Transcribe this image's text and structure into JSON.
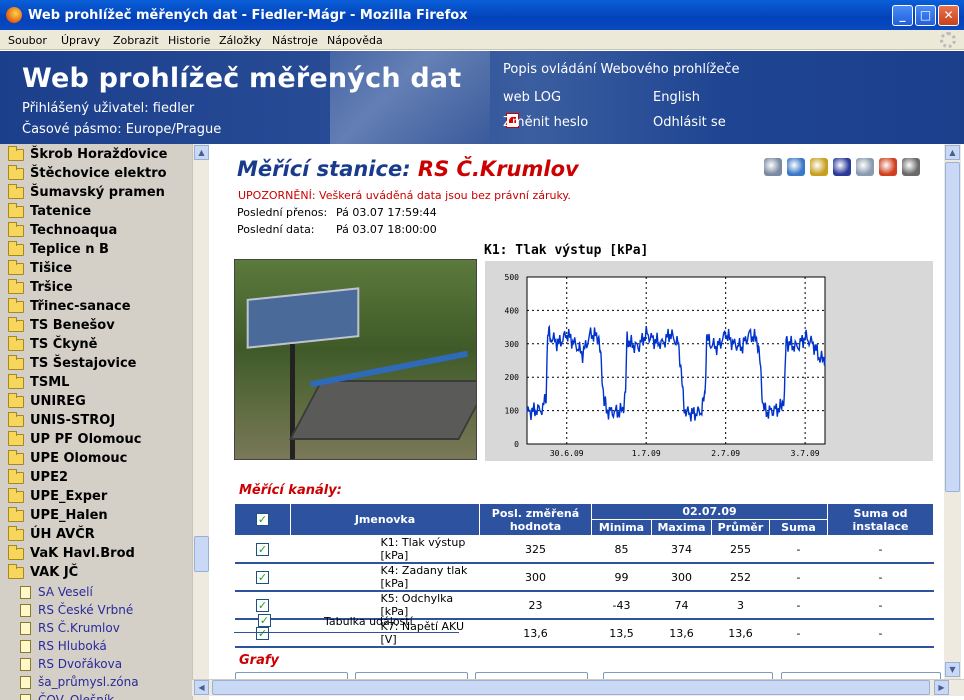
{
  "window": {
    "title": "Web prohlížeč měřených dat - Fiedler-Mágr - Mozilla Firefox"
  },
  "menu": [
    "Soubor",
    "Úpravy",
    "Zobrazit",
    "Historie",
    "Záložky",
    "Nástroje",
    "Nápověda"
  ],
  "banner": {
    "title": "Web prohlížeč měřených dat",
    "user": "Přihlášený uživatel: fiedler",
    "timezone": "Časové pásmo: Europe/Prague",
    "help_link": "Popis ovládání Webového prohlížeče",
    "weblog": "web LOG",
    "english": "English",
    "change_password": "Změnit heslo",
    "logout": "Odhlásit se"
  },
  "sidebar": {
    "folders": [
      "Škrob Horažďovice",
      "Štěchovice elektro",
      "Šumavský pramen",
      "Tatenice",
      "Technoaqua",
      "Teplice n B",
      "Tišice",
      "Tršice",
      "Třinec-sanace",
      "TS Benešov",
      "TS Čkyně",
      "TS Šestajovice",
      "TSML",
      "UNIREG",
      "UNIS-STROJ",
      "UP PF Olomouc",
      "UPE Olomouc",
      "UPE2",
      "UPE_Exper",
      "UPE_Halen",
      "ÚH AVČR",
      "VaK Havl.Brod",
      "VAK JČ"
    ],
    "subitems": [
      "SA Veselí",
      "RS České Vrbné",
      "RS Č.Krumlov",
      "RS Hluboká",
      "RS Dvořákova",
      "ša_průmysl.zóna",
      "ČOV_Olešník"
    ]
  },
  "station": {
    "prefix": "Měřící stanice:",
    "name": "RS Č.Krumlov",
    "warning": "UPOZORNĚNÍ: Veškerá uváděná data jsou bez právní záruky.",
    "last_transfer_label": "Poslední přenos:",
    "last_transfer": "Pá 03.07 17:59:44",
    "last_data_label": "Poslední data:",
    "last_data": "Pá 03.07 18:00:00"
  },
  "tool_icons": [
    "wrench-icon",
    "refresh-icon",
    "sum-icon",
    "report-icon",
    "export-icon",
    "alarm-icon",
    "settings-icon"
  ],
  "chart_title": "K1:  Tlak výstup [kPa]",
  "chart_data": {
    "type": "line",
    "title": "K1:  Tlak výstup [kPa]",
    "ylim": [
      0,
      500
    ],
    "yticks": [
      0,
      100,
      200,
      300,
      400,
      500
    ],
    "xticks": [
      "30.6.09",
      "1.7.09",
      "2.7.09",
      "3.7.09"
    ],
    "grid": true,
    "x_days": [
      0.0,
      0.1,
      0.2,
      0.24,
      0.26,
      0.3,
      0.4,
      0.5,
      0.6,
      0.7,
      0.8,
      0.9,
      0.93,
      0.97,
      1.0,
      1.1,
      1.2,
      1.24,
      1.26,
      1.3,
      1.4,
      1.5,
      1.6,
      1.7,
      1.8,
      1.9,
      1.93,
      1.97,
      2.0,
      2.1,
      2.2,
      2.24,
      2.26,
      2.3,
      2.4,
      2.5,
      2.6,
      2.7,
      2.8,
      2.9,
      2.93,
      2.97,
      3.0,
      3.1,
      3.2,
      3.24,
      3.26,
      3.3,
      3.4,
      3.5,
      3.6,
      3.7,
      3.75
    ],
    "values": [
      95,
      100,
      105,
      150,
      330,
      320,
      300,
      330,
      300,
      270,
      330,
      320,
      250,
      130,
      100,
      95,
      100,
      150,
      320,
      300,
      290,
      330,
      310,
      300,
      330,
      300,
      250,
      120,
      95,
      90,
      100,
      150,
      320,
      300,
      290,
      330,
      300,
      290,
      330,
      310,
      250,
      120,
      95,
      100,
      110,
      150,
      310,
      300,
      290,
      320,
      300,
      250,
      260
    ]
  },
  "channels": {
    "section_title": "Měřící kanály:",
    "headers": {
      "name": "Jmenovka",
      "last": "Posl. změřená hodnota",
      "date": "02.07.09",
      "min": "Minima",
      "max": "Maxima",
      "avg": "Průměr",
      "sum": "Suma",
      "total": "Suma od instalace"
    },
    "rows": [
      {
        "name": "K1: Tlak výstup [kPa]",
        "last": "325",
        "min": "85",
        "max": "374",
        "avg": "255",
        "sum": "-",
        "total": "-"
      },
      {
        "name": "K4: Zadany tlak [kPa]",
        "last": "300",
        "min": "99",
        "max": "300",
        "avg": "252",
        "sum": "-",
        "total": "-"
      },
      {
        "name": "K5: Odchylka [kPa]",
        "last": "23",
        "min": "-43",
        "max": "74",
        "avg": "3",
        "sum": "-",
        "total": "-"
      },
      {
        "name": "K7: Napětí AKU [V]",
        "last": "13,6",
        "min": "13,5",
        "max": "13,6",
        "avg": "13,6",
        "sum": "-",
        "total": "-"
      }
    ],
    "events": "Tabulka událostí"
  },
  "graphs_title": "Grafy",
  "colors": {
    "banner": "#1c3f8c",
    "header": "#2d52a0",
    "accent": "#c00000",
    "line": "#0033cc"
  }
}
